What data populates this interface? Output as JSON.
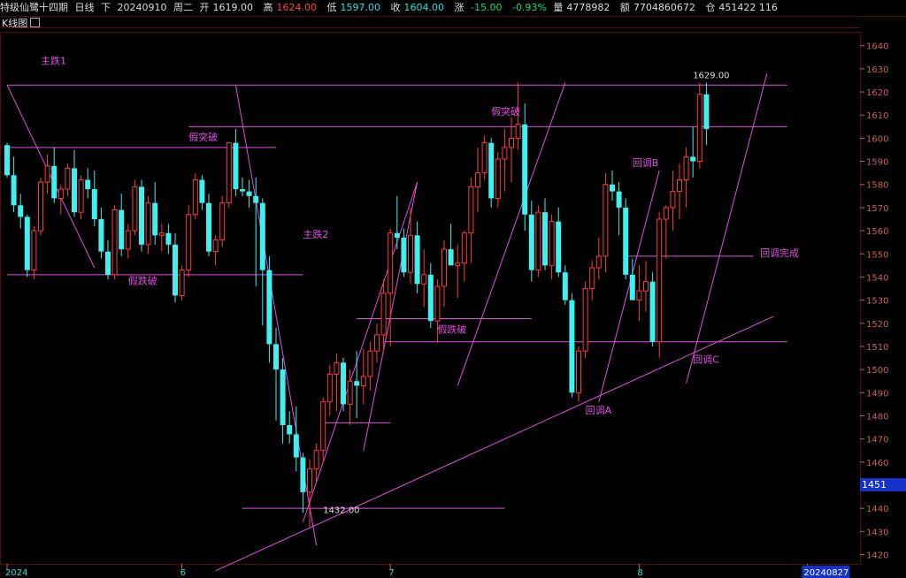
{
  "header": {
    "name": "特级仙鹭十四期",
    "period": "日线",
    "mode": "下",
    "date": "20240910",
    "weekday": "周二",
    "open_label": "开",
    "open": "1619.00",
    "high_label": "高",
    "high": "1624.00",
    "low_label": "低",
    "low": "1597.00",
    "close_label": "收",
    "close": "1604.00",
    "change_label": "涨",
    "change": "-15.00",
    "change_pct": "-0.93%",
    "volume_label": "量",
    "volume": "4778982",
    "amount_label": "额",
    "amount": "7704860672",
    "position_label": "仓",
    "position": "451422 116"
  },
  "subtitle": "K线图",
  "last_price": "1451",
  "colors": {
    "up": "#ff3b3b",
    "down": "#3ff0ef",
    "annotation": "#e050e0",
    "grid": "#5a0a0a",
    "axis_text": "#c86060"
  },
  "chart_data": {
    "type": "candlestick",
    "ylim": [
      1416,
      1646
    ],
    "yticks": [
      1420,
      1430,
      1440,
      1450,
      1460,
      1470,
      1480,
      1490,
      1500,
      1510,
      1520,
      1530,
      1540,
      1550,
      1560,
      1570,
      1580,
      1590,
      1600,
      1610,
      1620,
      1630,
      1640
    ],
    "x_labels": [
      "2024",
      "6",
      "7",
      "8",
      "20240827"
    ],
    "x_label_index": [
      0,
      26,
      57,
      94,
      119
    ],
    "candles": [
      [
        1597,
        1598,
        1583,
        1584
      ],
      [
        1584,
        1592,
        1568,
        1571
      ],
      [
        1571,
        1576,
        1561,
        1566
      ],
      [
        1566,
        1567,
        1540,
        1543
      ],
      [
        1543,
        1562,
        1539,
        1560
      ],
      [
        1560,
        1583,
        1558,
        1581
      ],
      [
        1581,
        1593,
        1576,
        1588
      ],
      [
        1588,
        1596,
        1572,
        1574
      ],
      [
        1574,
        1580,
        1567,
        1578
      ],
      [
        1578,
        1589,
        1575,
        1587
      ],
      [
        1587,
        1595,
        1566,
        1568
      ],
      [
        1568,
        1584,
        1565,
        1582
      ],
      [
        1582,
        1587,
        1574,
        1578
      ],
      [
        1578,
        1586,
        1562,
        1565
      ],
      [
        1565,
        1570,
        1548,
        1551
      ],
      [
        1551,
        1556,
        1539,
        1541
      ],
      [
        1541,
        1571,
        1539,
        1569
      ],
      [
        1569,
        1576,
        1549,
        1552
      ],
      [
        1552,
        1563,
        1548,
        1560
      ],
      [
        1560,
        1582,
        1558,
        1579
      ],
      [
        1579,
        1582,
        1551,
        1554
      ],
      [
        1554,
        1575,
        1550,
        1572
      ],
      [
        1572,
        1581,
        1554,
        1558
      ],
      [
        1558,
        1563,
        1551,
        1559
      ],
      [
        1559,
        1563,
        1550,
        1554
      ],
      [
        1554,
        1559,
        1529,
        1532
      ],
      [
        1532,
        1545,
        1530,
        1543
      ],
      [
        1543,
        1571,
        1540,
        1567
      ],
      [
        1567,
        1585,
        1565,
        1582
      ],
      [
        1582,
        1584,
        1569,
        1572
      ],
      [
        1572,
        1576,
        1549,
        1551
      ],
      [
        1551,
        1558,
        1545,
        1556
      ],
      [
        1556,
        1575,
        1553,
        1572
      ],
      [
        1572,
        1589,
        1570,
        1598
      ],
      [
        1598,
        1604,
        1575,
        1578
      ],
      [
        1578,
        1583,
        1575,
        1577
      ],
      [
        1577,
        1582,
        1570,
        1575
      ],
      [
        1575,
        1583,
        1536,
        1572
      ],
      [
        1572,
        1574,
        1519,
        1543
      ],
      [
        1543,
        1549,
        1503,
        1511
      ],
      [
        1511,
        1518,
        1478,
        1500
      ],
      [
        1500,
        1505,
        1468,
        1476
      ],
      [
        1476,
        1482,
        1468,
        1472
      ],
      [
        1472,
        1484,
        1456,
        1462
      ],
      [
        1462,
        1464,
        1438,
        1447
      ],
      [
        1447,
        1461,
        1432,
        1457
      ],
      [
        1457,
        1468,
        1451,
        1465
      ],
      [
        1465,
        1488,
        1460,
        1486
      ],
      [
        1486,
        1502,
        1480,
        1498
      ],
      [
        1498,
        1507,
        1482,
        1503
      ],
      [
        1503,
        1505,
        1482,
        1485
      ],
      [
        1485,
        1500,
        1476,
        1495
      ],
      [
        1495,
        1508,
        1479,
        1493
      ],
      [
        1493,
        1509,
        1485,
        1497
      ],
      [
        1497,
        1512,
        1491,
        1508
      ],
      [
        1508,
        1520,
        1503,
        1515
      ],
      [
        1515,
        1539,
        1508,
        1533
      ],
      [
        1533,
        1561,
        1510,
        1559
      ],
      [
        1559,
        1575,
        1552,
        1557
      ],
      [
        1557,
        1561,
        1540,
        1542
      ],
      [
        1542,
        1570,
        1537,
        1558
      ],
      [
        1558,
        1564,
        1533,
        1537
      ],
      [
        1537,
        1552,
        1527,
        1541
      ],
      [
        1541,
        1546,
        1518,
        1521
      ],
      [
        1521,
        1539,
        1512,
        1536
      ],
      [
        1536,
        1556,
        1527,
        1552
      ],
      [
        1552,
        1563,
        1545,
        1545
      ],
      [
        1545,
        1554,
        1531,
        1546
      ],
      [
        1546,
        1560,
        1538,
        1559
      ],
      [
        1559,
        1583,
        1546,
        1579
      ],
      [
        1579,
        1596,
        1568,
        1585
      ],
      [
        1585,
        1601,
        1582,
        1598
      ],
      [
        1598,
        1600,
        1570,
        1574
      ],
      [
        1574,
        1594,
        1570,
        1591
      ],
      [
        1591,
        1604,
        1577,
        1596
      ],
      [
        1596,
        1609,
        1581,
        1600
      ],
      [
        1600,
        1624,
        1595,
        1606
      ],
      [
        1606,
        1615,
        1560,
        1567
      ],
      [
        1567,
        1573,
        1538,
        1543
      ],
      [
        1543,
        1571,
        1540,
        1568
      ],
      [
        1568,
        1574,
        1543,
        1545
      ],
      [
        1545,
        1567,
        1539,
        1564
      ],
      [
        1564,
        1570,
        1540,
        1542
      ],
      [
        1542,
        1545,
        1528,
        1530
      ],
      [
        1530,
        1533,
        1488,
        1490
      ],
      [
        1490,
        1510,
        1486,
        1508
      ],
      [
        1508,
        1538,
        1505,
        1535
      ],
      [
        1535,
        1547,
        1530,
        1544
      ],
      [
        1544,
        1557,
        1539,
        1549
      ],
      [
        1549,
        1585,
        1542,
        1580
      ],
      [
        1580,
        1586,
        1573,
        1577
      ],
      [
        1577,
        1581,
        1558,
        1570
      ],
      [
        1570,
        1574,
        1539,
        1541
      ],
      [
        1541,
        1548,
        1533,
        1530
      ],
      [
        1530,
        1545,
        1521,
        1534
      ],
      [
        1534,
        1547,
        1525,
        1538
      ],
      [
        1538,
        1542,
        1510,
        1512
      ],
      [
        1512,
        1568,
        1505,
        1565
      ],
      [
        1565,
        1571,
        1548,
        1570
      ],
      [
        1570,
        1586,
        1560,
        1577
      ],
      [
        1577,
        1589,
        1565,
        1582
      ],
      [
        1582,
        1596,
        1570,
        1592
      ],
      [
        1592,
        1605,
        1583,
        1590
      ],
      [
        1590,
        1624,
        1587,
        1619
      ],
      [
        1619,
        1624,
        1597,
        1604
      ]
    ],
    "hlines": [
      {
        "y": 1623,
        "i0": 0,
        "i1": 116
      },
      {
        "y": 1605,
        "i0": 27,
        "i1": 116
      },
      {
        "y": 1596,
        "i0": 0,
        "i1": 40
      },
      {
        "y": 1541,
        "i0": 0,
        "i1": 44
      },
      {
        "y": 1522,
        "i0": 52,
        "i1": 78
      },
      {
        "y": 1512,
        "i0": 56,
        "i1": 116
      },
      {
        "y": 1549,
        "i0": 92,
        "i1": 111
      },
      {
        "y": 1477,
        "i0": 47,
        "i1": 57
      },
      {
        "y": 1440,
        "i0": 35,
        "i1": 74
      }
    ],
    "slines": [
      {
        "x1": 0,
        "y1": 1623,
        "x2": 13,
        "y2": 1544
      },
      {
        "x1": 34,
        "y1": 1623,
        "x2": 46,
        "y2": 1424
      },
      {
        "x1": 44,
        "y1": 1434,
        "x2": 61,
        "y2": 1581
      },
      {
        "x1": 53,
        "y1": 1465,
        "x2": 61,
        "y2": 1581
      },
      {
        "x1": 67,
        "y1": 1493,
        "x2": 83,
        "y2": 1624
      },
      {
        "x1": 88,
        "y1": 1486,
        "x2": 97,
        "y2": 1586
      },
      {
        "x1": 31,
        "y1": 1413,
        "x2": 114,
        "y2": 1523
      },
      {
        "x1": 101,
        "y1": 1494,
        "x2": 113,
        "y2": 1628
      }
    ],
    "annotations": [
      {
        "text": "主跌1",
        "i": 5,
        "y": 1632
      },
      {
        "text": "假突破",
        "i": 27,
        "y": 1599
      },
      {
        "text": "假跌破",
        "i": 18,
        "y": 1537
      },
      {
        "text": "主跌2",
        "i": 44,
        "y": 1557
      },
      {
        "text": "假突破",
        "i": 72,
        "y": 1610
      },
      {
        "text": "假跌破",
        "i": 64,
        "y": 1516
      },
      {
        "text": "回调B",
        "i": 93,
        "y": 1588
      },
      {
        "text": "回调完成",
        "i": 112,
        "y": 1549
      },
      {
        "text": "回调C",
        "i": 102,
        "y": 1503
      },
      {
        "text": "回调A",
        "i": 86,
        "y": 1481
      }
    ],
    "price_labels": [
      {
        "text": "1629.00",
        "i": 102,
        "y": 1626
      },
      {
        "text": "1432.00",
        "i": 47,
        "y": 1438
      }
    ]
  }
}
